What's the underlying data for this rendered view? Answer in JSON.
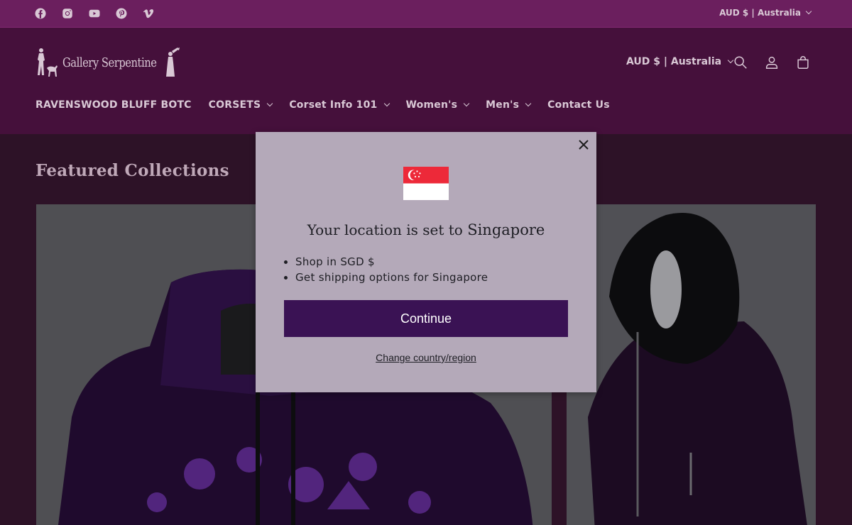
{
  "topbar": {
    "social_icons": [
      "facebook-icon",
      "instagram-icon",
      "youtube-icon",
      "pinterest-icon",
      "vimeo-icon"
    ],
    "currency": "AUD $ | Australia"
  },
  "header": {
    "logo_text": "Gallery Serpentine",
    "currency": "AUD $ | Australia",
    "icons": [
      "search-icon",
      "account-icon",
      "cart-icon"
    ],
    "nav": [
      {
        "label": "RAVENSWOOD BLUFF BOTC",
        "has_dropdown": false
      },
      {
        "label": "CORSETS",
        "has_dropdown": true
      },
      {
        "label": "Corset Info 101",
        "has_dropdown": true
      },
      {
        "label": "Women's",
        "has_dropdown": true
      },
      {
        "label": "Men's",
        "has_dropdown": true
      },
      {
        "label": "Contact Us",
        "has_dropdown": false
      }
    ]
  },
  "main": {
    "section_title": "Featured Collections"
  },
  "modal": {
    "title_prefix": "Your location is set to",
    "country": "Singapore",
    "items": [
      "Shop in SGD $",
      "Get shipping options for Singapore"
    ],
    "continue_label": "Continue",
    "change_label": "Change country/region"
  },
  "colors": {
    "topbar_bg": "#6b1f5e",
    "header_bg": "#45103b",
    "modal_bg": "#b4a9b9",
    "button_bg": "#3a1254"
  }
}
